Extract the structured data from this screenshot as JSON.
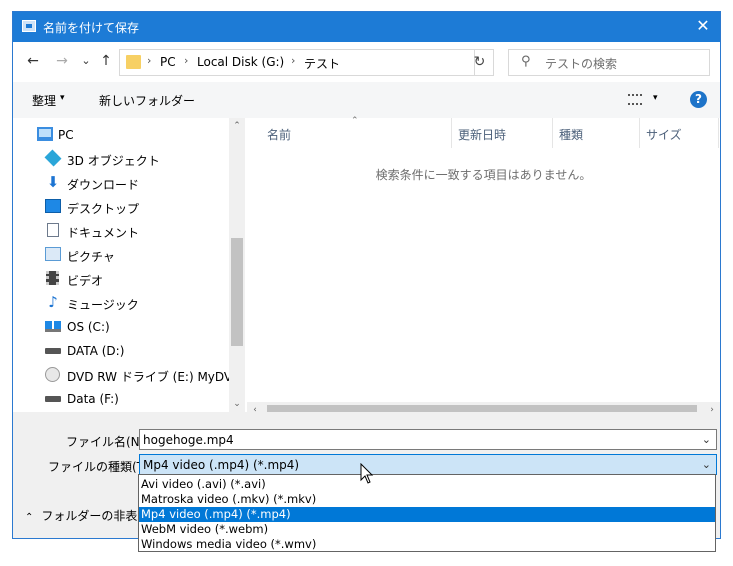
{
  "window": {
    "title": "名前を付けて保存",
    "close_symbol": "✕"
  },
  "nav": {
    "back": "←",
    "forward": "→",
    "recent": "⌄",
    "up": "↑",
    "path": [
      "PC",
      "Local Disk (G:)",
      "テスト"
    ],
    "path_sep": "›",
    "refresh": "↻",
    "search_icon": "⚲",
    "search_placeholder": "テストの検索"
  },
  "toolbar": {
    "organize": "整理",
    "organize_caret": "▾",
    "new_folder": "新しいフォルダー",
    "view_caret": "▾",
    "help": "?"
  },
  "sidebar": {
    "items": [
      {
        "label": "PC",
        "icon": "pc-icon",
        "color": "#3a8de0"
      },
      {
        "label": "3D オブジェクト",
        "icon": "cube-icon",
        "color": "#2aa6d9"
      },
      {
        "label": "ダウンロード",
        "icon": "download-icon",
        "color": "#1c74d2"
      },
      {
        "label": "デスクトップ",
        "icon": "desktop-icon",
        "color": "#1e88e5"
      },
      {
        "label": "ドキュメント",
        "icon": "document-icon",
        "color": "#6d7a8c"
      },
      {
        "label": "ピクチャ",
        "icon": "picture-icon",
        "color": "#5a9bd5"
      },
      {
        "label": "ビデオ",
        "icon": "video-icon",
        "color": "#444444"
      },
      {
        "label": "ミュージック",
        "icon": "music-icon",
        "color": "#1c74d2"
      },
      {
        "label": "OS (C:)",
        "icon": "windows-drive-icon",
        "color": "#1e88e5"
      },
      {
        "label": "DATA (D:)",
        "icon": "drive-icon",
        "color": "#555555"
      },
      {
        "label": "DVD RW ドライブ (E:) MyDVD",
        "icon": "dvd-icon",
        "color": "#999999"
      },
      {
        "label": "Data (F:)",
        "icon": "drive-icon",
        "color": "#555555"
      }
    ],
    "scroll_up": "⌃",
    "scroll_down": "⌄"
  },
  "filelist": {
    "columns": [
      "名前",
      "更新日時",
      "種類",
      "サイズ"
    ],
    "sort_indicator": "⌃",
    "empty_message": "検索条件に一致する項目はありません。",
    "scroll_left": "‹",
    "scroll_right": "›"
  },
  "form": {
    "filename_label": "ファイル名(N):",
    "filename_value": "hogehoge.mp4",
    "filetype_label": "ファイルの種類(T):",
    "filetype_value": "Mp4 video (.mp4) (*.mp4)",
    "caret": "⌄",
    "hide_folders_chevron": "⌃",
    "hide_folders": "フォルダーの非表示"
  },
  "dropdown": {
    "options": [
      "Avi video (.avi) (*.avi)",
      "Matroska video (.mkv) (*.mkv)",
      "Mp4 video (.mp4) (*.mp4)",
      "WebM video (*.webm)",
      "Windows media video (*.wmv)"
    ],
    "selected_index": 2
  },
  "colors": {
    "accent": "#1d7bd6",
    "selection": "#0078d7"
  }
}
